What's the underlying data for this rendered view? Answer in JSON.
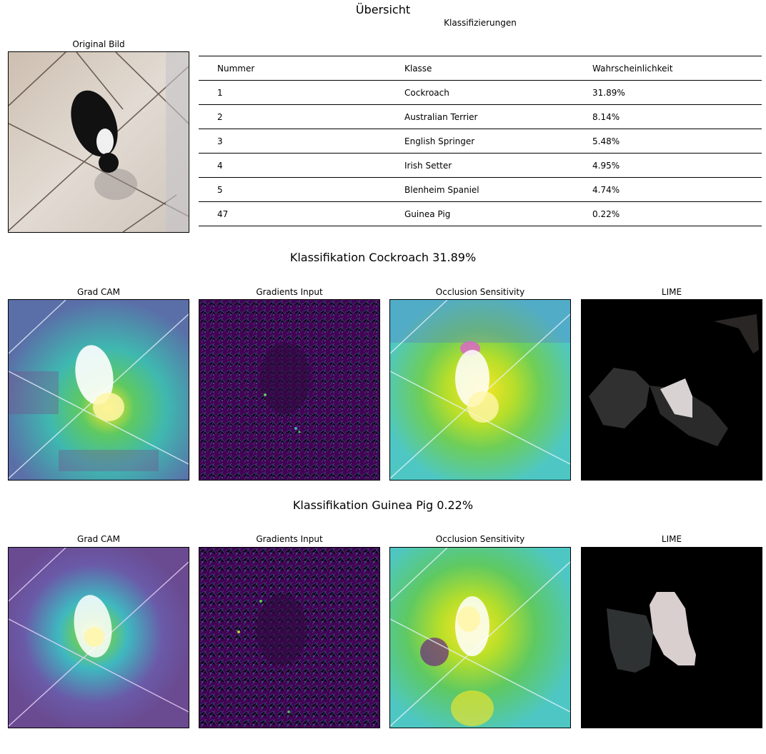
{
  "suptitle": "Übersicht",
  "original": {
    "title": "Original Bild"
  },
  "table": {
    "title": "Klassifizierungen",
    "columns": [
      "Nummer",
      "Klasse",
      "Wahrscheinlichkeit"
    ],
    "rows": [
      [
        "1",
        "Cockroach",
        "31.89%"
      ],
      [
        "2",
        "Australian Terrier",
        "8.14%"
      ],
      [
        "3",
        "English Springer",
        "5.48%"
      ],
      [
        "4",
        "Irish Setter",
        "4.95%"
      ],
      [
        "5",
        "Blenheim Spaniel",
        "4.74%"
      ],
      [
        "47",
        "Guinea Pig",
        "0.22%"
      ]
    ]
  },
  "sections": [
    {
      "title": "Klassifikation Cockroach 31.89%",
      "panels": [
        "Grad CAM",
        "Gradients Input",
        "Occlusion Sensitivity",
        "LIME"
      ]
    },
    {
      "title": "Klassifikation Guinea Pig 0.22%",
      "panels": [
        "Grad CAM",
        "Gradients Input",
        "Occlusion Sensitivity",
        "LIME"
      ]
    }
  ],
  "colors": {
    "viridis_dark": "#440154",
    "viridis_teal": "#21918c",
    "viridis_yellow": "#fde725",
    "floor": "#d9d1c8",
    "lime_background": "#000000"
  }
}
